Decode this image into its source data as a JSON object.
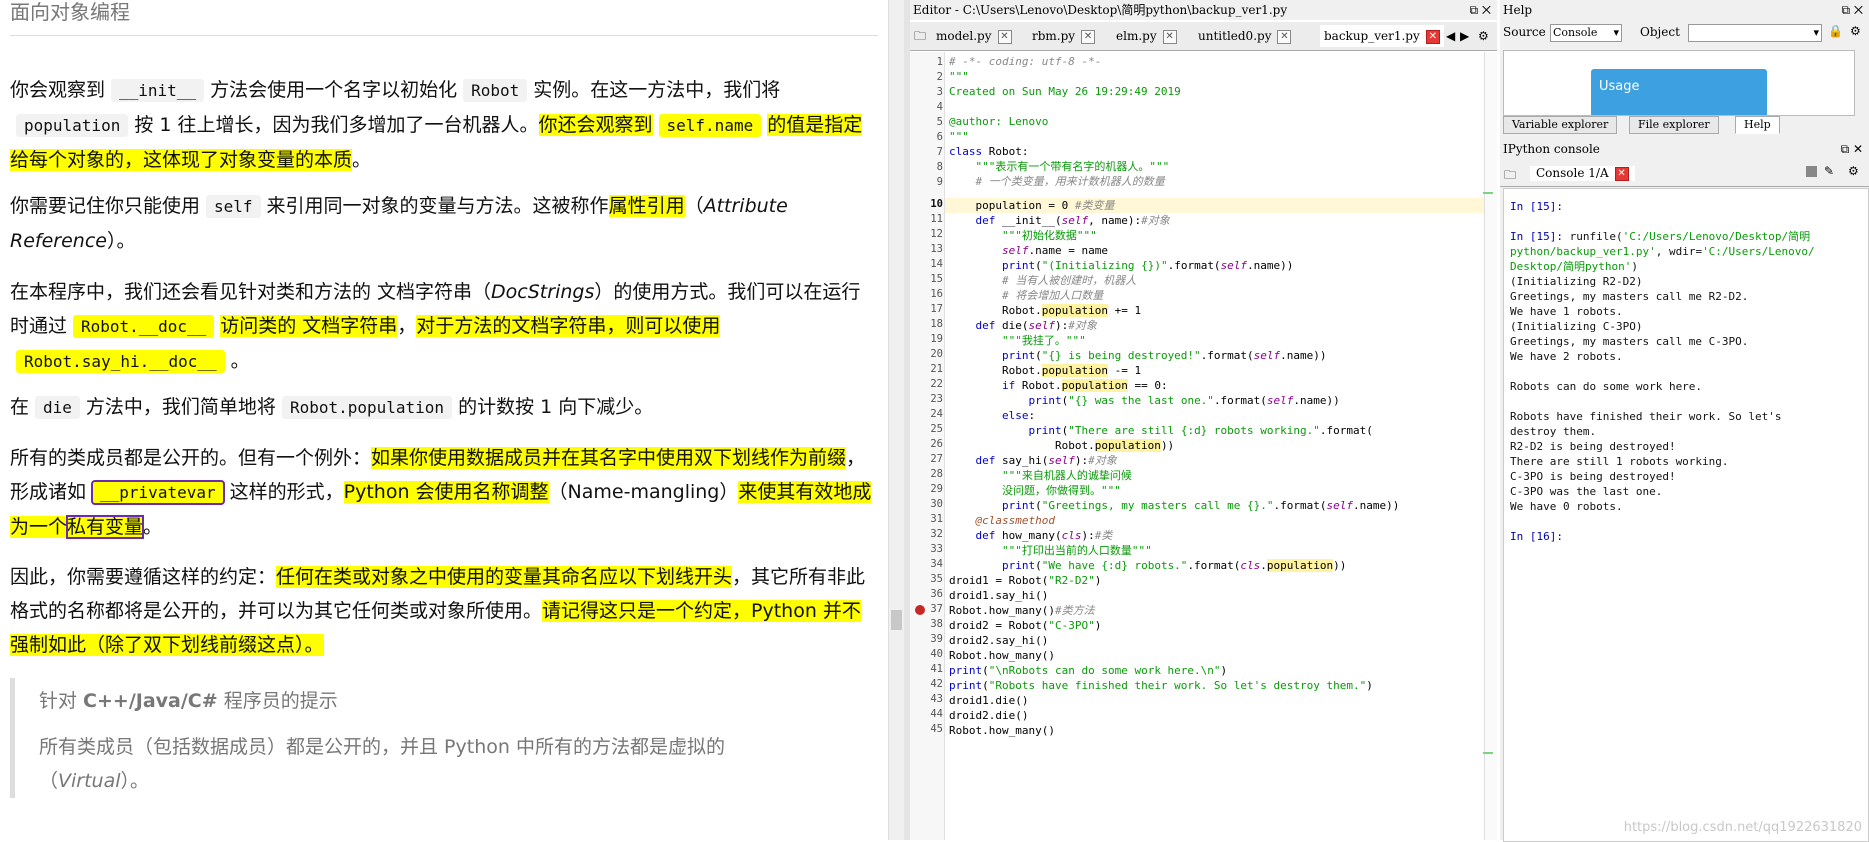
{
  "doc": {
    "section_title": "面向对象编程",
    "p1": {
      "t1": "你会观察到",
      "c1": "__init__",
      "t2": "方法会使用一个名字以初始化",
      "c2": "Robot",
      "t3": "实例。在这一方法中，我们将",
      "c3": "population",
      "t4": "按 1 往上增长，因为我们多增加了一台机器人。",
      "h1": "你还会观察到",
      "c4": "self.name",
      "h2": "的值是指定给每个对象的，这体现了对象变量的本质",
      "t5": "。"
    },
    "p2": {
      "t1": "你需要记住你只能使用",
      "c1": "self",
      "t2": "来引用同一对象的变量与方法。这被称作",
      "h1": "属性引用",
      "t3": "（",
      "e1": "Attribute Reference",
      "t4": "）。"
    },
    "p3": {
      "t1": "在本程序中，我们还会看见针对类和方法的 文档字符串（",
      "e1": "DocStrings",
      "t2": "）的使用方式。我们可以在运行时通过",
      "c1": "Robot.__doc__",
      "h1": "访问类的 文档字符串",
      "t3": "，",
      "h2": "对于方法的文档字符串，则可以使用",
      "c2": "Robot.say_hi.__doc__",
      "t4": "。"
    },
    "p4": {
      "t1": "在",
      "c1": "die",
      "t2": "方法中，我们简单地将",
      "c2": "Robot.population",
      "t3": "的计数按 1 向下减少。"
    },
    "p5": {
      "t1": "所有的类成员都是公开的。但有一个例外：",
      "h1": "如果你使用数据成员并在其名字中使用双下划线作为前缀",
      "t2": "，形成诸如",
      "c1": "__privatevar",
      "t3": "这样的形式，",
      "h2": "Python 会使用名称调整",
      "t4": "（Name-mangling）",
      "h3": "来使其有效地成为一个",
      "h4": "私有变量",
      "t5": "。"
    },
    "p6": {
      "t1": "因此，你需要遵循这样的约定：",
      "h1": "任何在类或对象之中使用的变量其命名应以下划线开头",
      "t2": "，其它所有非此格式的名称都将是公开的，并可以为其它任何类或对象所使用。",
      "h2": "请记得这只是一个约定，Python 并不强制如此（除了双下划线前缀这点）。"
    },
    "tip": {
      "title_t1": "针对 ",
      "title_b": "C++/Java/C#",
      "title_t2": " 程序员的提示",
      "body_t1": "所有类成员（包括数据成员）都是公开的，并且 Python 中所有的方法都是虚拟的（",
      "body_e": "Virtual",
      "body_t2": "）。"
    }
  },
  "editor": {
    "title": "Editor - C:\\Users\\Lenovo\\Desktop\\简明python\\backup_ver1.py",
    "tabs": [
      "model.py",
      "rbm.py",
      "elm.py",
      "untitled0.py",
      "backup_ver1.py"
    ],
    "current_line": "10"
  },
  "right": {
    "help_title": "Help",
    "source_label": "Source",
    "source_value": "Console",
    "object_label": "Object",
    "usage_label": "Usage",
    "tabs": [
      "Variable explorer",
      "File explorer",
      "Help"
    ],
    "ipython_title": "IPython console",
    "console_tab": "Console 1/A",
    "watermark": "https://blog.csdn.net/qq1922631820"
  },
  "colors": {
    "highlight": "#ffff00",
    "usage": "#3da0e0",
    "string": "#0a9a0a",
    "keyword": "#0000cc"
  }
}
